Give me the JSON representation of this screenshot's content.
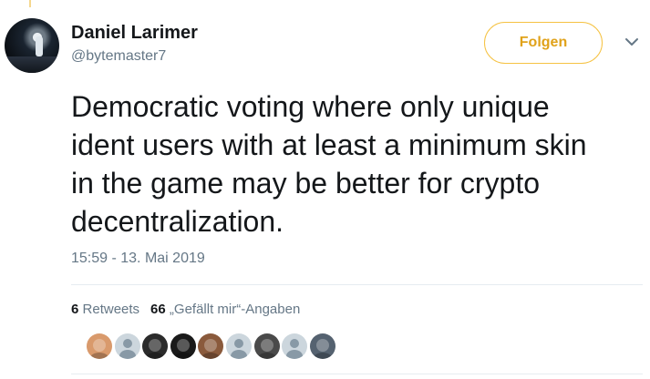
{
  "tweet": {
    "author_name": "Daniel Larimer",
    "author_handle": "@bytemaster7",
    "follow_label": "Folgen",
    "text": "Democratic voting where only unique\nident users with at least a minimum skin\nin the game may be better for crypto\ndecentralization.",
    "timestamp": "15:59 - 13. Mai 2019"
  },
  "stats": {
    "retweets_count": "6",
    "retweets_label": "Retweets",
    "likes_count": "66",
    "likes_label": "„Gefällt mir“-Angaben"
  },
  "likers": [
    {
      "kind": "photo",
      "color": "#d99a6c"
    },
    {
      "kind": "default",
      "color": "#8899a6"
    },
    {
      "kind": "photo",
      "color": "#2b2b2b"
    },
    {
      "kind": "photo",
      "color": "#1a1a1a"
    },
    {
      "kind": "photo",
      "color": "#8a5a3c"
    },
    {
      "kind": "default",
      "color": "#8899a6"
    },
    {
      "kind": "photo",
      "color": "#4a4a4a"
    },
    {
      "kind": "default",
      "color": "#8899a6"
    },
    {
      "kind": "photo",
      "color": "#556270"
    }
  ],
  "colors": {
    "accent": "#e0a21a",
    "accent_border": "#f5c242",
    "muted_text": "#657786",
    "main_text": "#14171a"
  },
  "icons": {
    "more": "chevron-down-icon"
  }
}
